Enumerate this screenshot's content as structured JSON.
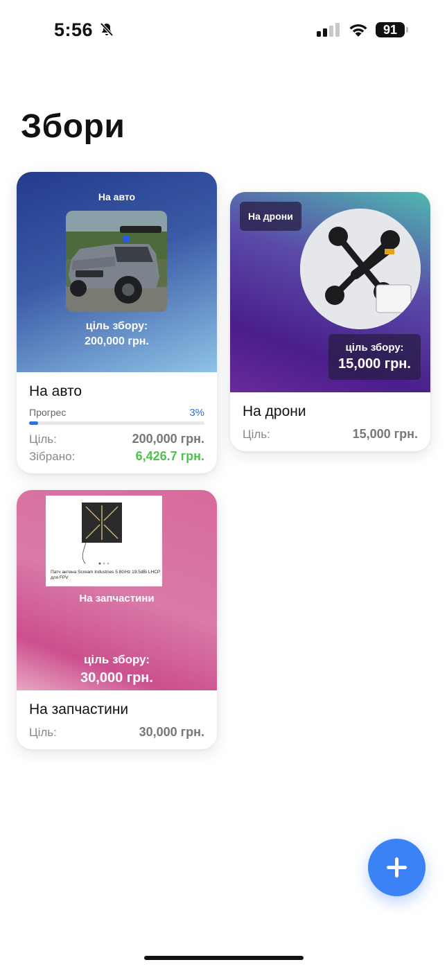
{
  "status_bar": {
    "time": "5:56",
    "battery": "91"
  },
  "page": {
    "title": "Збори"
  },
  "labels": {
    "goal": "Ціль:",
    "collected": "Зібрано:",
    "progress": "Прогрес",
    "goal_banner": "ціль збору:"
  },
  "cards": [
    {
      "name": "На авто",
      "hero_title": "На авто",
      "goal_amount": "200,000 грн.",
      "progress": 0.03,
      "progress_text": "3%",
      "collected": "6,426.7 грн."
    },
    {
      "name": "На дрони",
      "hero_title": "На дрони",
      "goal_amount": "15,000 грн."
    },
    {
      "name": "На запчастини",
      "hero_title": "На запчастини",
      "goal_amount": "30,000 грн.",
      "product_caption": "Патч антена Scream Industries 5.8GHz 19.5dBi LHCP для FPV"
    }
  ],
  "colors": {
    "accent": "#3b82f6",
    "collected": "#4cc34c",
    "progress": "#2f6fd6"
  },
  "icons": {
    "fab": "plus-icon",
    "bell": "bell-slash-icon"
  }
}
